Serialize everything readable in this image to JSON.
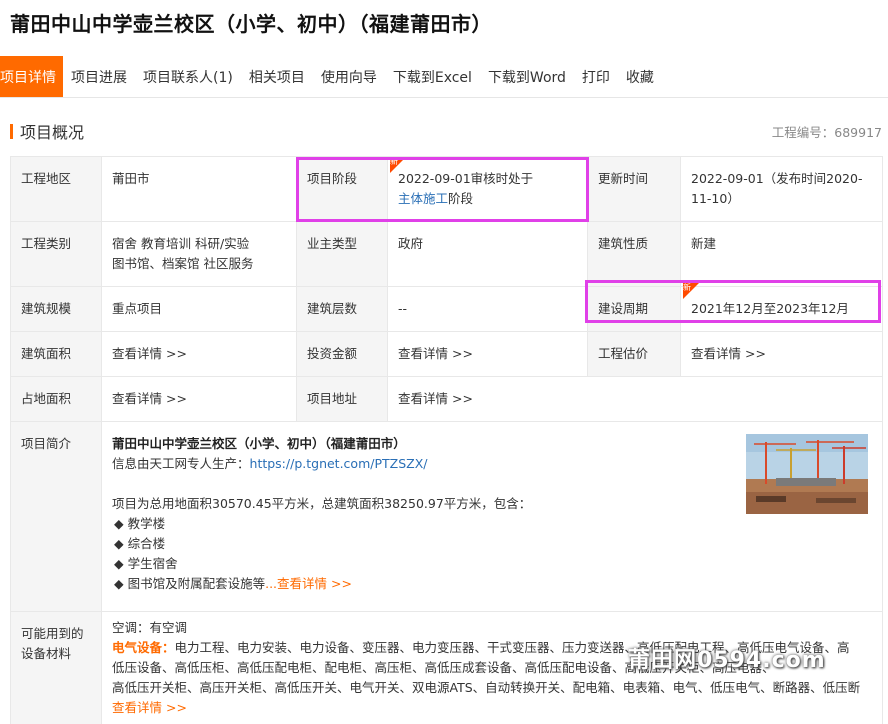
{
  "page": {
    "title": "莆田中山中学壶兰校区（小学、初中）（福建莆田市）"
  },
  "tabs": [
    "项目详情",
    "项目进展",
    "项目联系人(1)",
    "相关项目",
    "使用向导",
    "下载到Excel",
    "下载到Word",
    "打印",
    "收藏"
  ],
  "section": {
    "title": "项目概况",
    "project_no": "工程编号：689917"
  },
  "row1": {
    "region_label": "工程地区",
    "region_value": "莆田市",
    "stage_label": "项目阶段",
    "stage_prefix": "2022-09-01审核时处于",
    "stage_link": "主体施工",
    "stage_suffix": "阶段",
    "update_label": "更新时间",
    "update_value": "2022-09-01（发布时间2020-11-10）"
  },
  "row2": {
    "type_label": "工程类别",
    "type_line1": "宿舍 教育培训 科研/实验",
    "type_line2": "图书馆、档案馆 社区服务",
    "owner_label": "业主类型",
    "owner_value": "政府",
    "nature_label": "建筑性质",
    "nature_value": "新建"
  },
  "row3": {
    "scale_label": "建筑规模",
    "scale_value": "重点项目",
    "floors_label": "建筑层数",
    "floors_value": "--",
    "period_label": "建设周期",
    "period_value": "2021年12月至2023年12月"
  },
  "row4": {
    "area_label": "建筑面积",
    "area_value": "查看详情 >>",
    "invest_label": "投资金额",
    "invest_value": "查看详情 >>",
    "estimate_label": "工程估价",
    "estimate_value": "查看详情 >>"
  },
  "row5": {
    "land_label": "占地面积",
    "land_value": "查看详情 >>",
    "addr_label": "项目地址",
    "addr_value": "查看详情 >>"
  },
  "brief": {
    "label": "项目简介",
    "title": "莆田中山中学壶兰校区（小学、初中）（福建莆田市）",
    "source_prefix": "信息由天工网专人生产：",
    "source_link": "https://p.tgnet.com/PTZSZX/",
    "summary": "项目为总用地面积30570.45平方米，总建筑面积38250.97平方米，包含：",
    "items": [
      "教学楼",
      "综合楼",
      "学生宿舍",
      "图书馆及附属配套设施等"
    ],
    "more": "...查看详情 >>",
    "new_tag": "新"
  },
  "materials": {
    "label": "可能用到的设备材料",
    "aircon": "空调：有空调",
    "elec_label": "电气设备：",
    "elec_line1": "电力工程、电力安装、电力设备、变压器、电力变压器、干式变压器、压力变送器、高低压配电工程、高低压电气设备、高",
    "elec_line2": "低压设备、高低压柜、高低压配电柜、配电柜、高压柜、高低压成套设备、高低压配电设备、高低压开关柜、高压电器、",
    "elec_line3": "高低压开关柜、高压开关柜、高低压开关、电气开关、双电源ATS、自动转换开关、配电箱、电表箱、电气、低压电气、断路器、低压断",
    "more": "查看详情 >>"
  },
  "watermark": "莆田网0594.com"
}
